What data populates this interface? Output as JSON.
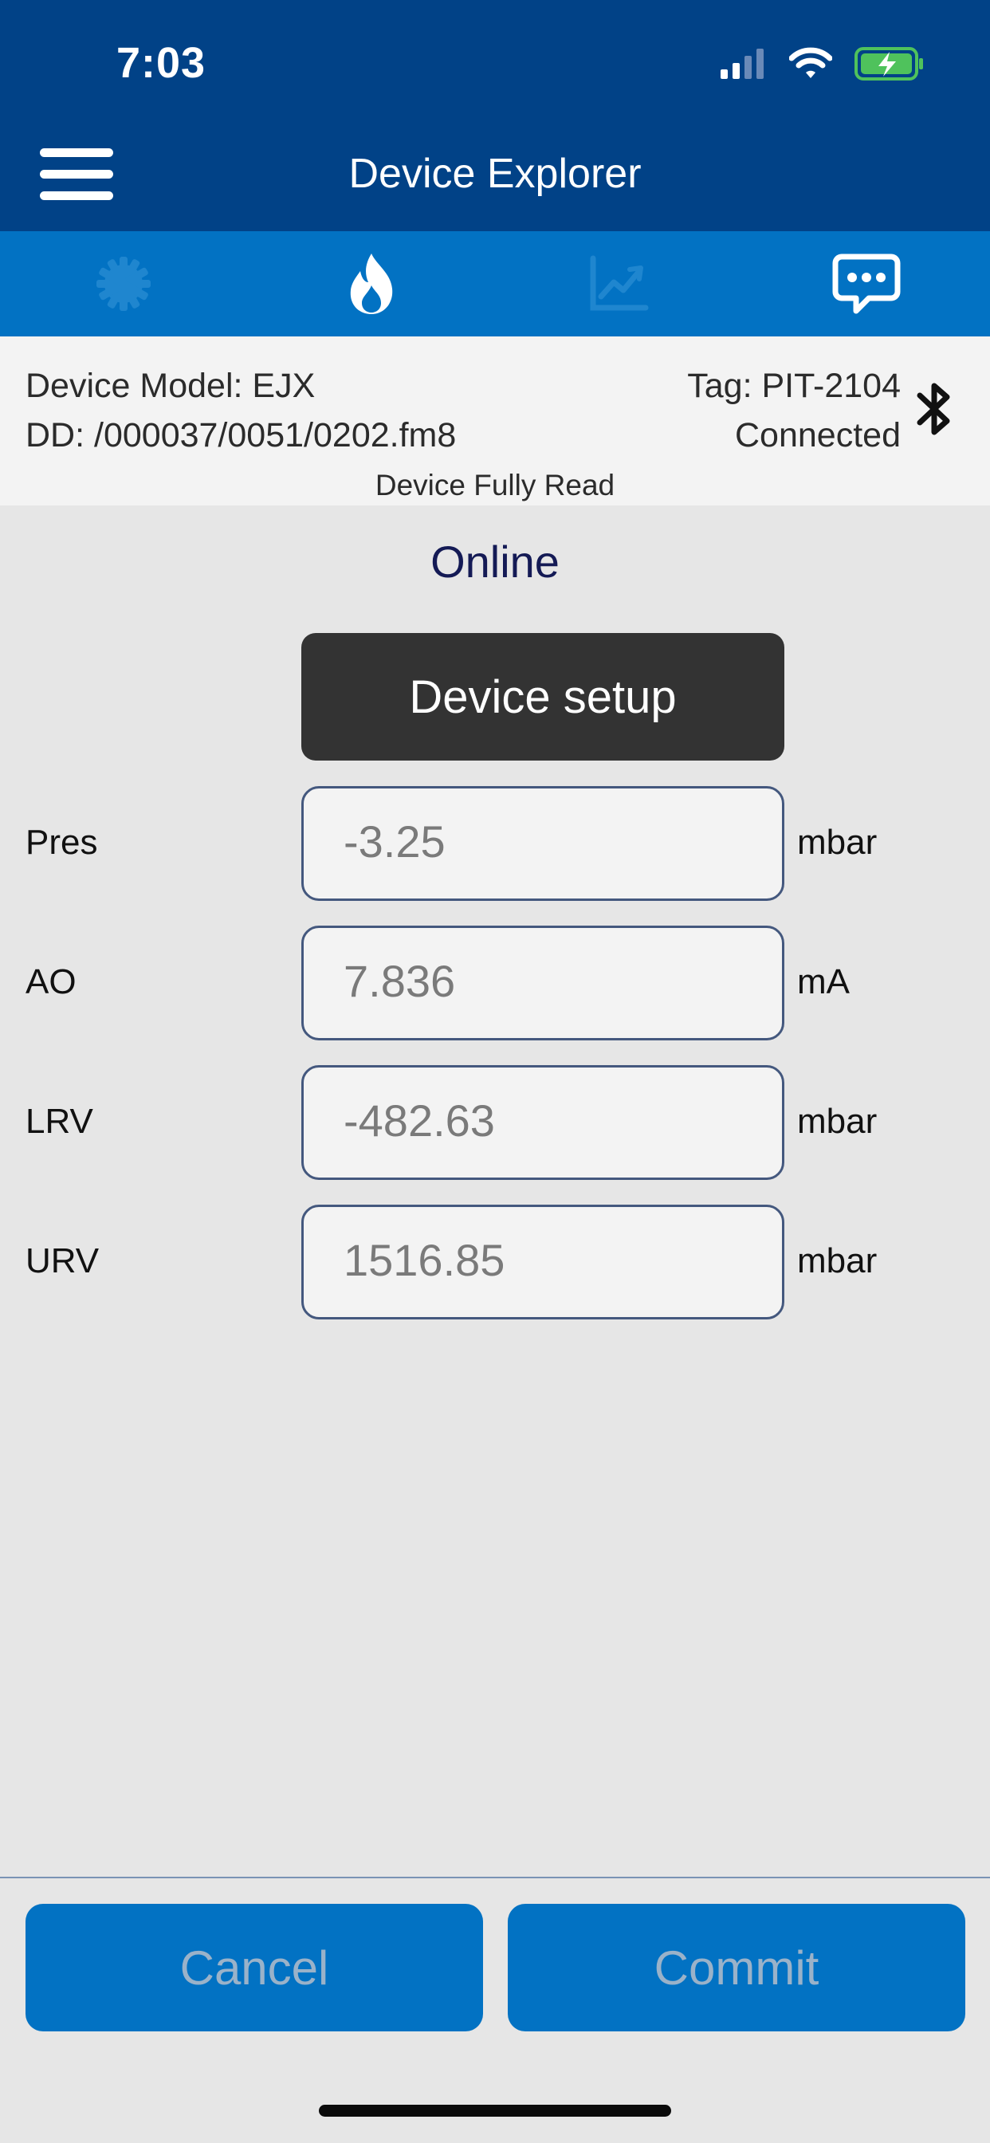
{
  "status": {
    "time": "7:03"
  },
  "header": {
    "title": "Device Explorer"
  },
  "tabs": [
    {
      "icon": "gear-icon",
      "state": "dimmed"
    },
    {
      "icon": "flame-icon",
      "state": "active"
    },
    {
      "icon": "chart-icon",
      "state": "dimmed"
    },
    {
      "icon": "message-icon",
      "state": "active"
    }
  ],
  "info": {
    "model": "Device Model:  EJX",
    "dd": "DD:  /000037/0051/0202.fm8",
    "tag": "Tag:  PIT-2104",
    "connection": "Connected",
    "read_status": "Device Fully Read"
  },
  "main": {
    "mode": "Online",
    "setup_button": "Device setup",
    "fields": [
      {
        "label": "Pres",
        "value": "-3.25",
        "unit": "mbar"
      },
      {
        "label": "AO",
        "value": "7.836",
        "unit": "mA"
      },
      {
        "label": "LRV",
        "value": "-482.63",
        "unit": "mbar"
      },
      {
        "label": "URV",
        "value": "1516.85",
        "unit": "mbar"
      }
    ]
  },
  "footer": {
    "cancel_label": "Cancel",
    "commit_label": "Commit"
  },
  "colors": {
    "header_bg": "#014287",
    "tab_bg": "#0272c3",
    "button_dark": "#333333",
    "accent_text": "#141a55"
  }
}
